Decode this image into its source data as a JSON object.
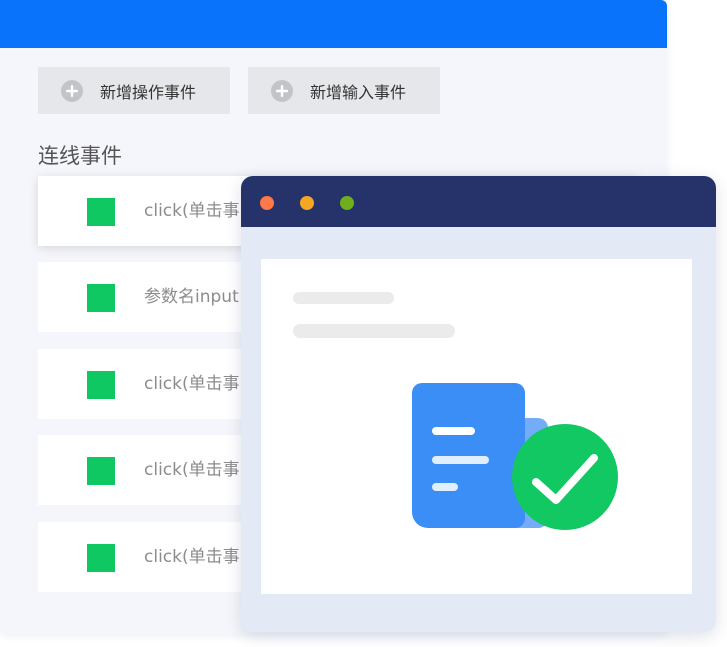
{
  "colors": {
    "header": "#0a73fb",
    "titlebar": "#26336b",
    "event_marker": "#0fc862",
    "doc_blue": "#3a8ef6",
    "success_green": "#11c863"
  },
  "toolbar": {
    "add_action_event": {
      "label": "新增操作事件",
      "icon": "plus-circle-icon"
    },
    "add_input_event": {
      "label": "新增输入事件",
      "icon": "plus-circle-icon"
    }
  },
  "section": {
    "title": "连线事件"
  },
  "events": [
    {
      "label": "click(单击事"
    },
    {
      "label": "参数名input"
    },
    {
      "label": "click(单击事"
    },
    {
      "label": "click(单击事"
    },
    {
      "label": "click(单击事"
    }
  ],
  "window": {
    "traffic_lights": [
      "#ff7847",
      "#f5a623",
      "#6fae1c"
    ],
    "content_icon": "document-check-icon"
  }
}
